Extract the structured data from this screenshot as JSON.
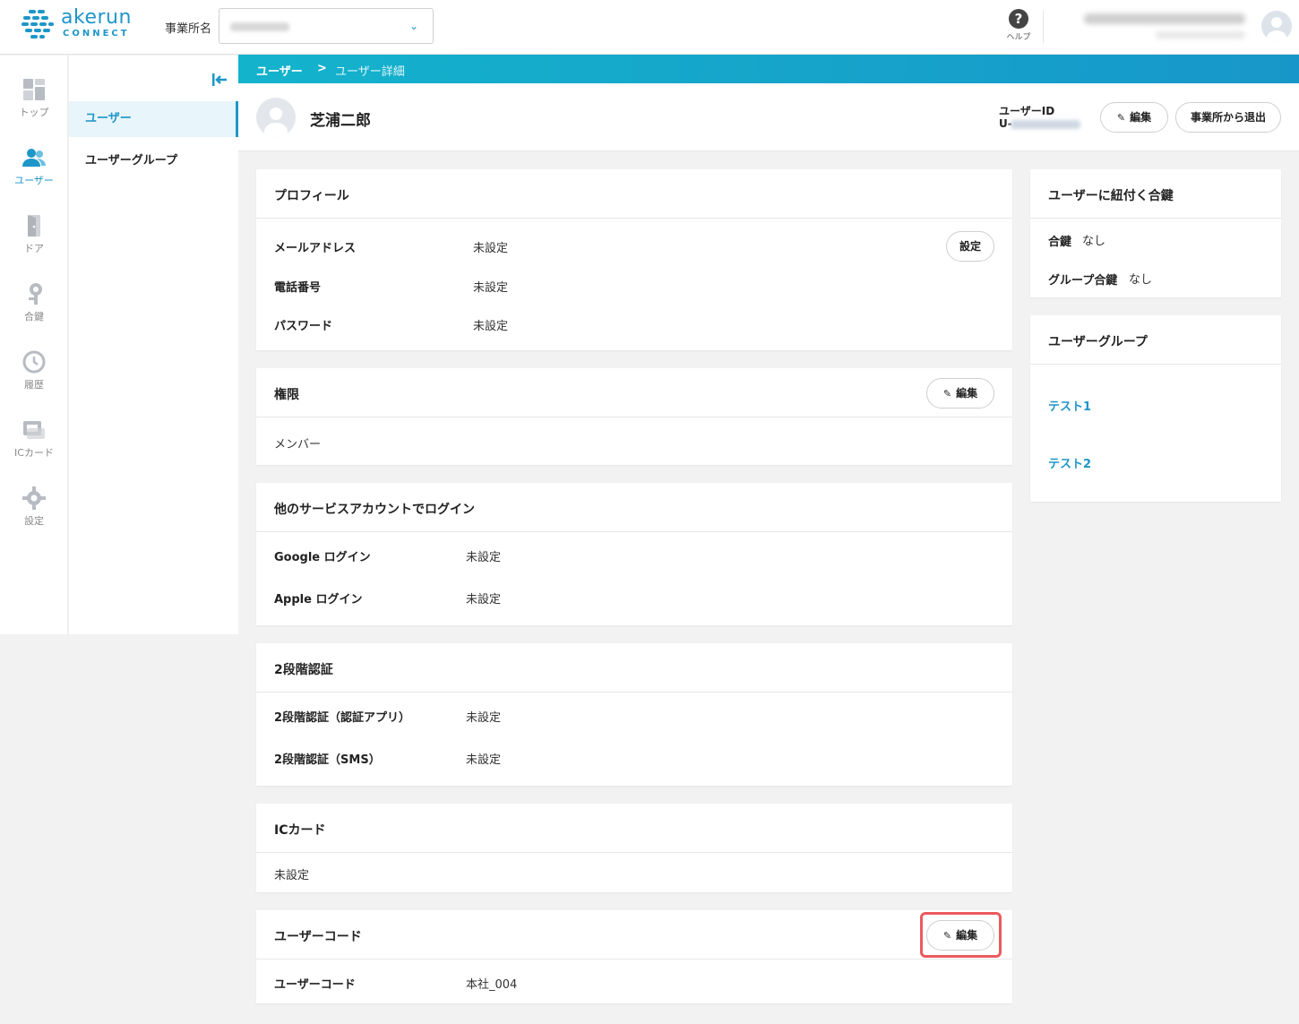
{
  "header": {
    "logo_text": "akerun",
    "logo_sub": "CONNECT",
    "office_label": "事業所名",
    "help_label": "ヘルプ"
  },
  "rail": [
    {
      "label": "トップ",
      "icon": "dashboard-icon"
    },
    {
      "label": "ユーザー",
      "icon": "users-icon",
      "active": true
    },
    {
      "label": "ドア",
      "icon": "door-icon"
    },
    {
      "label": "合鍵",
      "icon": "key-icon"
    },
    {
      "label": "履歴",
      "icon": "history-icon"
    },
    {
      "label": "ICカード",
      "icon": "ic-card-icon"
    },
    {
      "label": "設定",
      "icon": "gear-icon"
    }
  ],
  "subnav": {
    "items": [
      {
        "label": "ユーザー",
        "active": true
      },
      {
        "label": "ユーザーグループ"
      }
    ]
  },
  "breadcrumb": {
    "root": "ユーザー",
    "separator": ">",
    "current": "ユーザー詳細"
  },
  "user": {
    "name": "芝浦二郎",
    "id_label": "ユーザーID",
    "id_prefix": "U-",
    "edit_label": "編集",
    "leave_label": "事業所から退出"
  },
  "profile": {
    "title": "プロフィール",
    "set_label": "設定",
    "rows": [
      {
        "label": "メールアドレス",
        "value": "未設定"
      },
      {
        "label": "電話番号",
        "value": "未設定"
      },
      {
        "label": "パスワード",
        "value": "未設定"
      }
    ]
  },
  "permission": {
    "title": "権限",
    "edit_label": "編集",
    "value": "メンバー"
  },
  "social_login": {
    "title": "他のサービスアカウントでログイン",
    "rows": [
      {
        "label": "Google ログイン",
        "value": "未設定"
      },
      {
        "label": "Apple ログイン",
        "value": "未設定"
      }
    ]
  },
  "two_factor": {
    "title": "2段階認証",
    "rows": [
      {
        "label": "2段階認証（認証アプリ）",
        "value": "未設定"
      },
      {
        "label": "2段階認証（SMS）",
        "value": "未設定"
      }
    ]
  },
  "ic_card": {
    "title": "ICカード",
    "value": "未設定"
  },
  "user_code": {
    "title": "ユーザーコード",
    "edit_label": "編集",
    "row_label": "ユーザーコード",
    "row_value": "本社_004"
  },
  "keys": {
    "title": "ユーザーに紐付く合鍵",
    "rows": [
      {
        "label": "合鍵",
        "value": "なし"
      },
      {
        "label": "グループ合鍵",
        "value": "なし"
      }
    ]
  },
  "groups": {
    "title": "ユーザーグループ",
    "items": [
      "テスト1",
      "テスト2"
    ]
  },
  "colors": {
    "accent": "#1e96c8",
    "highlight": "#ec5a5f"
  }
}
